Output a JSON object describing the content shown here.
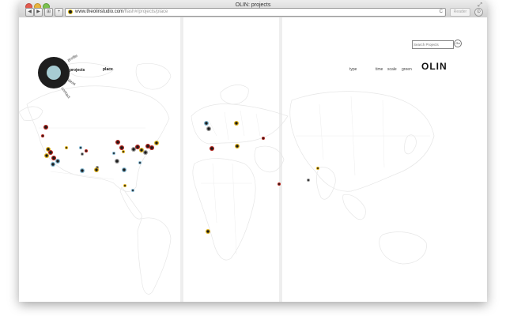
{
  "window": {
    "title": "OLIN: projects"
  },
  "browser": {
    "back_label": "◀",
    "forward_label": "▶",
    "sidebar_label": "⊞",
    "add_label": "+",
    "url_host": "www.theolinstudio.com",
    "url_path": "/flash#/projects/place",
    "reload_icon": "reload-icon",
    "reload_glyph": "C",
    "reader_label": "Reader",
    "download_glyph": "⊙"
  },
  "site": {
    "brand": "OLIN",
    "search_placeholder": "Search Projects",
    "go_label": "Go",
    "menu": {
      "profile": "profile",
      "projects": "projects",
      "ideas": "ideas",
      "contact": "contact"
    },
    "subnav": {
      "place": "place",
      "type": "type",
      "time": "time",
      "scale": "scale",
      "green": "green"
    },
    "logo_colors": {
      "ring": "#1e1e1e",
      "core": "#a7ccd3"
    }
  },
  "marker_colors": {
    "red": "#b0221a",
    "yellow": "#e0b21c",
    "blue": "#7fb3cc",
    "gray": "#9a9a9a",
    "dark": "#1a1a1a"
  },
  "map_markers": [
    {
      "ring": "red"
    },
    {
      "ring": "red"
    },
    {
      "ring": "yellow"
    },
    {
      "ring": "red"
    },
    {
      "ring": "yellow"
    },
    {
      "ring": "red"
    },
    {
      "ring": "blue"
    },
    {
      "ring": "blue"
    },
    {
      "ring": "yellow"
    },
    {
      "ring": "blue"
    },
    {
      "ring": "gray"
    },
    {
      "ring": "red"
    },
    {
      "ring": "gray"
    },
    {
      "ring": "yellow"
    },
    {
      "ring": "blue"
    },
    {
      "ring": "red"
    },
    {
      "ring": "red"
    },
    {
      "ring": "yellow"
    },
    {
      "ring": "blue"
    },
    {
      "ring": "gray"
    },
    {
      "ring": "blue"
    },
    {
      "ring": "yellow"
    },
    {
      "ring": "blue"
    },
    {
      "ring": "gray"
    },
    {
      "ring": "red"
    },
    {
      "ring": "yellow"
    },
    {
      "ring": "gray"
    },
    {
      "ring": "red"
    },
    {
      "ring": "red"
    },
    {
      "ring": "yellow"
    },
    {
      "ring": "blue"
    },
    {
      "ring": "blue"
    },
    {
      "ring": "gray"
    },
    {
      "ring": "yellow"
    },
    {
      "ring": "red"
    },
    {
      "ring": "yellow"
    },
    {
      "ring": "red"
    },
    {
      "ring": "yellow"
    },
    {
      "ring": "red"
    },
    {
      "ring": "gray"
    },
    {
      "ring": "yellow"
    }
  ]
}
